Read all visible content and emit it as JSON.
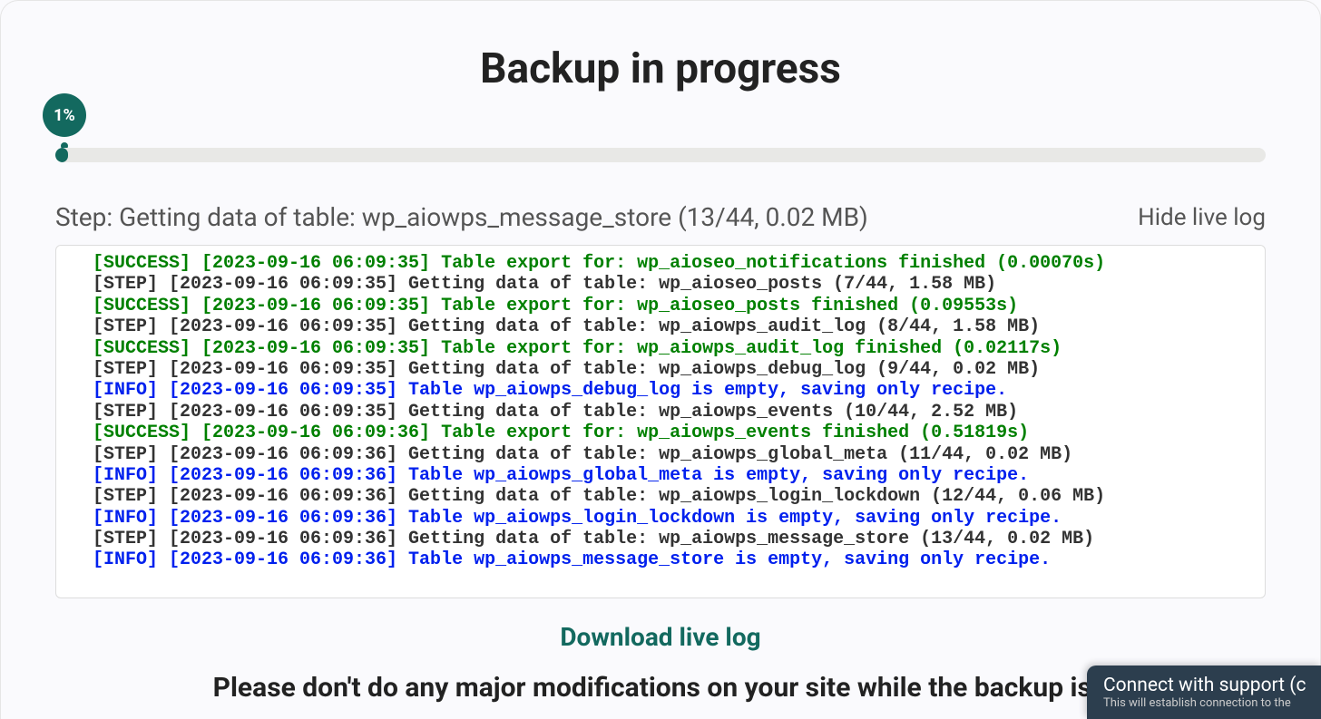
{
  "title": "Backup in progress",
  "progress": {
    "percent_label": "1%",
    "percent_value": 1
  },
  "step": {
    "prefix": "Step: ",
    "text": "Getting data of table: wp_aiowps_message_store (13/44, 0.02 MB)"
  },
  "hide_log_label": "Hide live log",
  "download_label": "Download live log",
  "warning_text": "Please don't do any major modifications on your site while the backup is r",
  "support_popup": {
    "title": "Connect with support (c",
    "subtitle": "This will establish connection to the"
  },
  "log_lines": [
    {
      "type": "success",
      "text": "[SUCCESS] [2023-09-16 06:09:35] Table export for: wp_aioseo_notifications finished (0.00070s)"
    },
    {
      "type": "step",
      "text": "[STEP] [2023-09-16 06:09:35] Getting data of table: wp_aioseo_posts (7/44, 1.58 MB)"
    },
    {
      "type": "success",
      "text": "[SUCCESS] [2023-09-16 06:09:35] Table export for: wp_aioseo_posts finished (0.09553s)"
    },
    {
      "type": "step",
      "text": "[STEP] [2023-09-16 06:09:35] Getting data of table: wp_aiowps_audit_log (8/44, 1.58 MB)"
    },
    {
      "type": "success",
      "text": "[SUCCESS] [2023-09-16 06:09:35] Table export for: wp_aiowps_audit_log finished (0.02117s)"
    },
    {
      "type": "step",
      "text": "[STEP] [2023-09-16 06:09:35] Getting data of table: wp_aiowps_debug_log (9/44, 0.02 MB)"
    },
    {
      "type": "info",
      "text": "[INFO] [2023-09-16 06:09:35] Table wp_aiowps_debug_log is empty, saving only recipe."
    },
    {
      "type": "step",
      "text": "[STEP] [2023-09-16 06:09:35] Getting data of table: wp_aiowps_events (10/44, 2.52 MB)"
    },
    {
      "type": "success",
      "text": "[SUCCESS] [2023-09-16 06:09:36] Table export for: wp_aiowps_events finished (0.51819s)"
    },
    {
      "type": "step",
      "text": "[STEP] [2023-09-16 06:09:36] Getting data of table: wp_aiowps_global_meta (11/44, 0.02 MB)"
    },
    {
      "type": "info",
      "text": "[INFO] [2023-09-16 06:09:36] Table wp_aiowps_global_meta is empty, saving only recipe."
    },
    {
      "type": "step",
      "text": "[STEP] [2023-09-16 06:09:36] Getting data of table: wp_aiowps_login_lockdown (12/44, 0.06 MB)"
    },
    {
      "type": "info",
      "text": "[INFO] [2023-09-16 06:09:36] Table wp_aiowps_login_lockdown is empty, saving only recipe."
    },
    {
      "type": "step",
      "text": "[STEP] [2023-09-16 06:09:36] Getting data of table: wp_aiowps_message_store (13/44, 0.02 MB)"
    },
    {
      "type": "info",
      "text": "[INFO] [2023-09-16 06:09:36] Table wp_aiowps_message_store is empty, saving only recipe."
    }
  ]
}
